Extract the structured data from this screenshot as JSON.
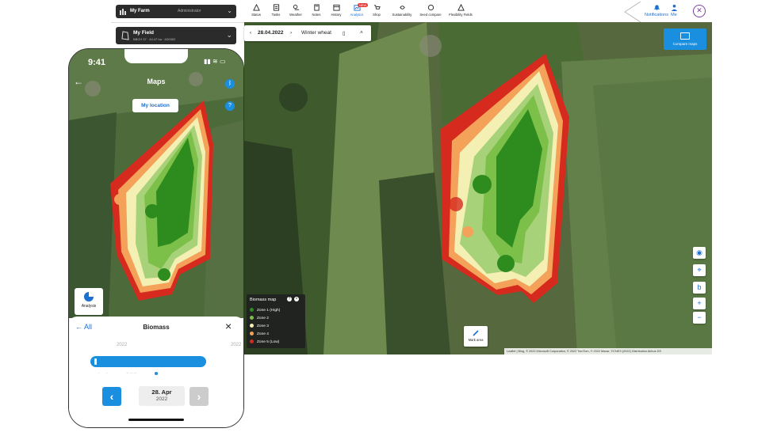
{
  "header": {
    "farm_name": "My Farm",
    "farm_role": "Administrator",
    "field_name": "My Field",
    "field_sub": "BBCH 37 · 44.47 ha · 4D0302",
    "nav": [
      {
        "label": "Status",
        "icon": "warning-icon"
      },
      {
        "label": "Tasks",
        "icon": "tasks-icon"
      },
      {
        "label": "Weather",
        "icon": "weather-icon"
      },
      {
        "label": "Notes",
        "icon": "notes-icon"
      },
      {
        "label": "History",
        "icon": "history-icon"
      },
      {
        "label": "Analytics",
        "icon": "analytics-icon",
        "badge": "NEW"
      },
      {
        "label": "Shop",
        "icon": "shop-icon"
      },
      {
        "label": "Sustainability",
        "icon": "sustainability-icon"
      },
      {
        "label": "Seed compare",
        "icon": "seed-icon"
      },
      {
        "label": "Flexibility Fields",
        "icon": "fields-icon"
      }
    ],
    "notifications_label": "Notifications",
    "me_label": "Me"
  },
  "map_toolbar": {
    "date": "28.04.2022",
    "crop": "Winter wheat"
  },
  "compare_button": "Compare maps",
  "legend": {
    "title": "Biomass map",
    "zones": [
      {
        "label": "Zone 1 (High)",
        "color": "#2e8b1e"
      },
      {
        "label": "Zone 2",
        "color": "#7cc04a"
      },
      {
        "label": "Zone 3",
        "color": "#f4f0b4"
      },
      {
        "label": "Zone 4",
        "color": "#f4a15a"
      },
      {
        "label": "Zone 5 (Low)",
        "color": "#d62a1e"
      }
    ]
  },
  "draw_button": "Mark area",
  "attribution": "Leaflet | Bing, © 2022 Microsoft Corporation, © 2022 TomTom, © 2022 Maxar, ©CNES (2022) Distribution Airbus DS",
  "phone": {
    "time": "9:41",
    "title": "Maps",
    "location_pill": "My location",
    "analysis_label": "Analysis",
    "sheet": {
      "back_label": "All",
      "title": "Biomass",
      "year_left": "2022",
      "year_right": "2022",
      "date_day": "28. Apr",
      "date_year": "2022"
    }
  }
}
